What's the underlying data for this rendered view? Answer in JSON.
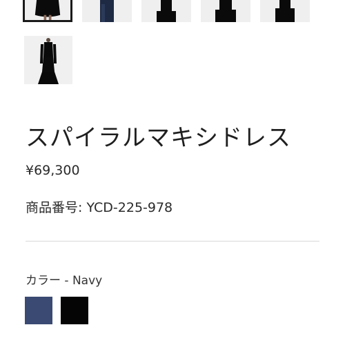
{
  "product": {
    "title": "スパイラルマキシドレス",
    "price": "¥69,300",
    "sku_label": "商品番号: YCD-225-978"
  },
  "color": {
    "label": "カラー - Navy",
    "options": [
      {
        "name": "navy",
        "hex": "#3a4a72"
      },
      {
        "name": "black",
        "hex": "#050505"
      }
    ]
  },
  "gallery": {
    "thumbnails": [
      {
        "icon": "dress-photo",
        "selected": true
      },
      {
        "icon": "dress-photo",
        "selected": false
      },
      {
        "icon": "dress-photo",
        "selected": false
      },
      {
        "icon": "dress-photo",
        "selected": false
      },
      {
        "icon": "dress-photo",
        "selected": false
      },
      {
        "icon": "dress-photo",
        "selected": false
      }
    ]
  }
}
